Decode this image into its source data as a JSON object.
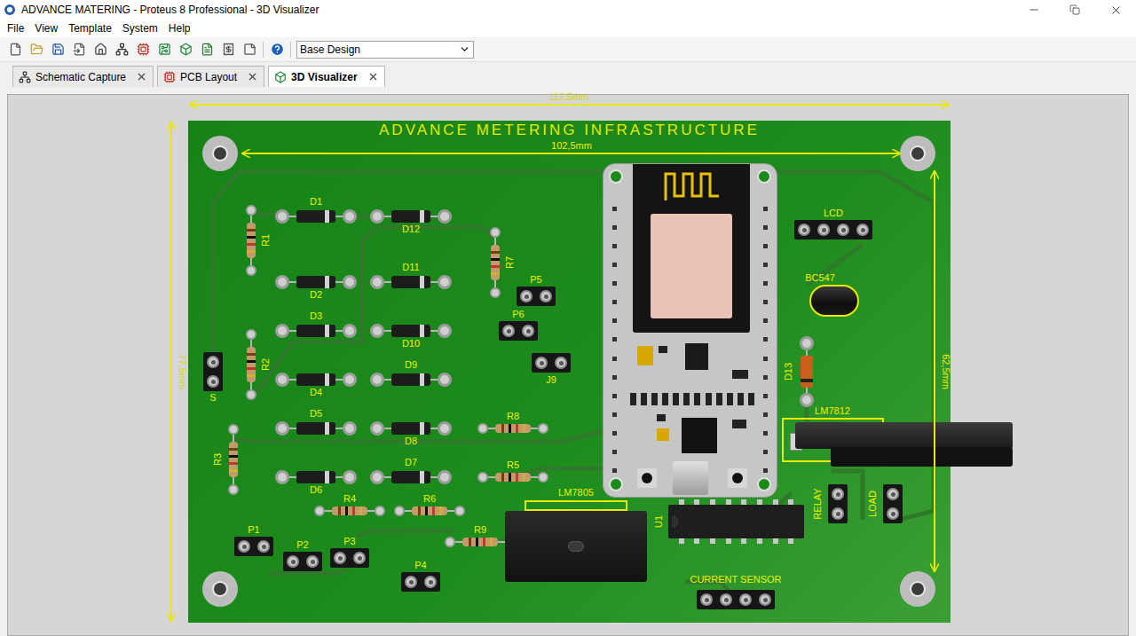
{
  "window": {
    "title": "ADVANCE MATERING - Proteus 8 Professional - 3D Visualizer"
  },
  "menu": [
    "File",
    "View",
    "Template",
    "System",
    "Help"
  ],
  "toolbar": {
    "variant": "Base Design"
  },
  "tabs": [
    {
      "label": "Schematic Capture",
      "selected": false
    },
    {
      "label": "PCB Layout",
      "selected": false
    },
    {
      "label": "3D Visualizer",
      "selected": true
    }
  ],
  "board": {
    "title": "ADVANCE METERING INFRASTRUCTURE",
    "dimensions": {
      "top": "112,5mm",
      "inner": "102,5mm",
      "left": "77,5mm",
      "right": "62,5mm"
    },
    "components": [
      {
        "label": "D1",
        "kind": "diode"
      },
      {
        "label": "D2",
        "kind": "diode"
      },
      {
        "label": "D3",
        "kind": "diode"
      },
      {
        "label": "D4",
        "kind": "diode"
      },
      {
        "label": "D5",
        "kind": "diode"
      },
      {
        "label": "D6",
        "kind": "diode"
      },
      {
        "label": "D7",
        "kind": "diode"
      },
      {
        "label": "D8",
        "kind": "diode"
      },
      {
        "label": "D9",
        "kind": "diode"
      },
      {
        "label": "D10",
        "kind": "diode"
      },
      {
        "label": "D11",
        "kind": "diode"
      },
      {
        "label": "D12",
        "kind": "diode"
      },
      {
        "label": "D13",
        "kind": "diode-v"
      },
      {
        "label": "R1",
        "kind": "resistor-v"
      },
      {
        "label": "R2",
        "kind": "resistor-v"
      },
      {
        "label": "R3",
        "kind": "resistor-v"
      },
      {
        "label": "R7",
        "kind": "resistor-v"
      },
      {
        "label": "R4",
        "kind": "resistor"
      },
      {
        "label": "R5",
        "kind": "resistor"
      },
      {
        "label": "R6",
        "kind": "resistor"
      },
      {
        "label": "R8",
        "kind": "resistor"
      },
      {
        "label": "R9",
        "kind": "resistor"
      },
      {
        "label": "P1",
        "kind": "header"
      },
      {
        "label": "P2",
        "kind": "header"
      },
      {
        "label": "P3",
        "kind": "header"
      },
      {
        "label": "P4",
        "kind": "header"
      },
      {
        "label": "P5",
        "kind": "header"
      },
      {
        "label": "P6",
        "kind": "header"
      },
      {
        "label": "J9",
        "kind": "header"
      },
      {
        "label": "S",
        "kind": "header-v"
      },
      {
        "label": "RELAY",
        "kind": "header-v"
      },
      {
        "label": "LOAD",
        "kind": "header-v"
      },
      {
        "label": "LCD",
        "kind": "header4"
      },
      {
        "label": "CURRENT SENSOR",
        "kind": "header4"
      },
      {
        "label": "BC547",
        "kind": "transistor"
      },
      {
        "label": "LM7805",
        "kind": "regulator"
      },
      {
        "label": "LM7812",
        "kind": "heatsink"
      },
      {
        "label": "U1",
        "kind": "dip"
      }
    ]
  }
}
